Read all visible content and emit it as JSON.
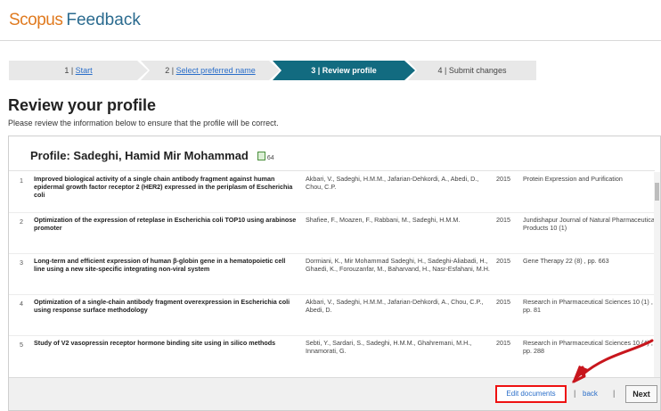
{
  "header": {
    "brand": "Scopus",
    "sub": "Feedback"
  },
  "steps": [
    {
      "num": "1 | ",
      "label": "Start"
    },
    {
      "num": "2 | ",
      "label": "Select preferred name"
    },
    {
      "num": "3 | ",
      "label": "Review profile"
    },
    {
      "num": "4 | ",
      "label": "Submit changes"
    }
  ],
  "page": {
    "title": "Review your profile",
    "subtitle": "Please review the information below to ensure that the profile will be correct."
  },
  "profile": {
    "title": "Profile: Sadeghi, Hamid Mir Mohammad",
    "doc_count": "64"
  },
  "documents": [
    {
      "num": "1",
      "title": "Improved biological activity of a single chain antibody fragment against human epidermal growth factor receptor 2 (HER2) expressed in the periplasm of Escherichia coli",
      "authors": "Akbari, V., Sadeghi, H.M.M., Jafarian-Dehkordi, A., Abedi, D., Chou, C.P.",
      "year": "2015",
      "source": "Protein Expression and Purification"
    },
    {
      "num": "2",
      "title": "Optimization of the expression of reteplase in Escherichia coli TOP10 using arabinose promoter",
      "authors": "Shafiee, F., Moazen, F., Rabbani, M., Sadeghi, H.M.M.",
      "year": "2015",
      "source": "Jundishapur Journal of Natural Pharmaceutical Products 10 (1)"
    },
    {
      "num": "3",
      "title": "Long-term and efficient expression of human β-globin gene in a hematopoietic cell line using a new site-specific integrating non-viral system",
      "authors": "Dormiani, K., Mir Mohammad Sadeghi, H., Sadeghi-Aliabadi, H., Ghaedi, K., Forouzanfar, M., Baharvand, H., Nasr-Esfahani, M.H.",
      "year": "2015",
      "source": "Gene Therapy 22 (8) , pp. 663"
    },
    {
      "num": "4",
      "title": "Optimization of a single-chain antibody fragment overexpression in Escherichia coli using response surface methodology",
      "authors": "Akbari, V., Sadeghi, H.M.M., Jafarian-Dehkordi, A., Chou, C.P., Abedi, D.",
      "year": "2015",
      "source": "Research in Pharmaceutical Sciences 10 (1) , pp. 81"
    },
    {
      "num": "5",
      "title": "Study of V2 vasopressin receptor hormone binding site using in silico methods",
      "authors": "Sebti, Y., Sardari, S., Sadeghi, H.M.M., Ghahremani, M.H., Innamorati, G.",
      "year": "2015",
      "source": "Research in Pharmaceutical Sciences 10 (4) , pp. 288"
    }
  ],
  "footer": {
    "edit": "Edit documents",
    "back": "back",
    "next": "Next",
    "sep": "|"
  },
  "colors": {
    "brand": "#e07a1f",
    "step_active": "#126b80",
    "link": "#2a6ec9",
    "highlight": "#e11111"
  }
}
